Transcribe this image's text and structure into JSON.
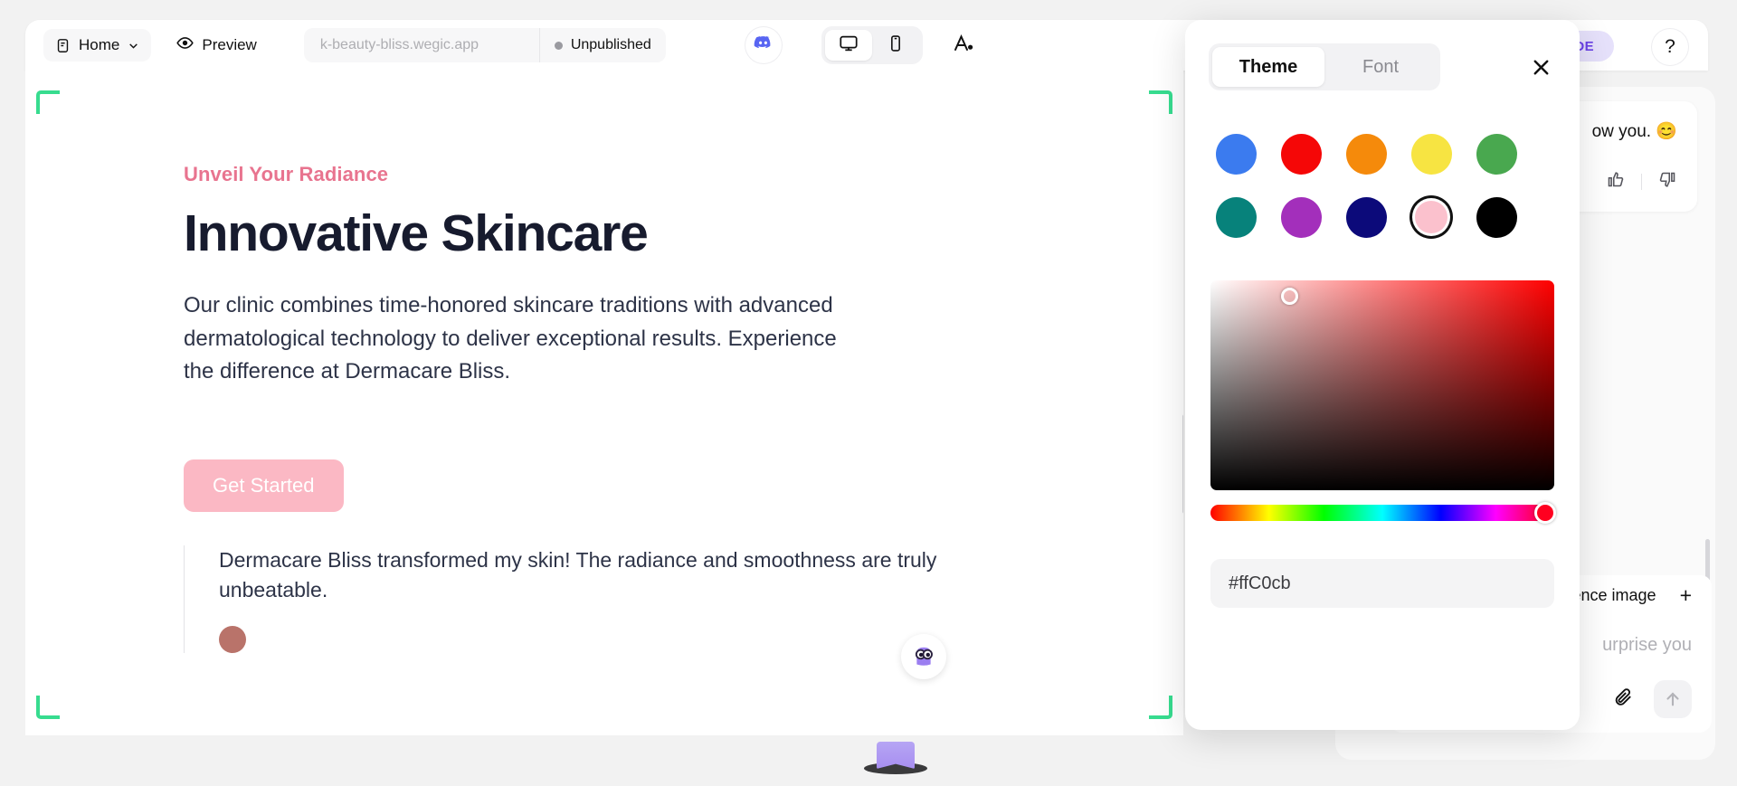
{
  "toolbar": {
    "home_label": "Home",
    "home_icon": "page-icon",
    "chevron_icon": "chevron-down-icon",
    "preview_label": "Preview",
    "preview_icon": "eye-icon",
    "url_value": "k-beauty-bliss.wegic.app",
    "status_label": "Unpublished",
    "discord_icon": "discord-icon",
    "desktop_icon": "desktop-monitor-icon",
    "mobile_icon": "mobile-phone-icon",
    "theme_icon": "font-color-icon",
    "upgrade_label": "GRADE",
    "help_label": "?"
  },
  "canvas": {
    "eyebrow": "Unveil Your Radiance",
    "title": "Innovative Skincare",
    "body": "Our clinic combines time-honored skincare traditions with advanced dermatological technology to deliver exceptional results. Experience the difference at Dermacare Bliss.",
    "cta_label": "Get Started",
    "testimonial": "Dermacare Bliss transformed my skin! The radiance and smoothness are truly unbeatable.",
    "mascot_icon": "mascot-avatar-icon"
  },
  "chat": {
    "message_text": "ow\nyou. 😊",
    "thumbs_up_icon": "thumbs-up-icon",
    "thumbs_down_icon": "thumbs-down-icon",
    "reference_label": "ence image",
    "plus_label": "+",
    "input_placeholder": "urprise you",
    "attach_icon": "paperclip-icon",
    "send_icon": "arrow-up-icon"
  },
  "theme_panel": {
    "tab_theme": "Theme",
    "tab_font": "Font",
    "active_tab": "Theme",
    "close_icon": "close-icon",
    "swatches": [
      {
        "name": "blue",
        "hex": "#3b7bef"
      },
      {
        "name": "red",
        "hex": "#f50707"
      },
      {
        "name": "orange",
        "hex": "#f58a0b"
      },
      {
        "name": "yellow",
        "hex": "#f7e442"
      },
      {
        "name": "green",
        "hex": "#49a84f"
      },
      {
        "name": "teal",
        "hex": "#07827b"
      },
      {
        "name": "purple",
        "hex": "#a32fbb"
      },
      {
        "name": "navy",
        "hex": "#0c0a7a"
      },
      {
        "name": "pink",
        "hex": "#fbc1cd"
      },
      {
        "name": "black",
        "hex": "#000000"
      }
    ],
    "selected_swatch_index": 8,
    "hex_value": "#ffC0cb"
  }
}
